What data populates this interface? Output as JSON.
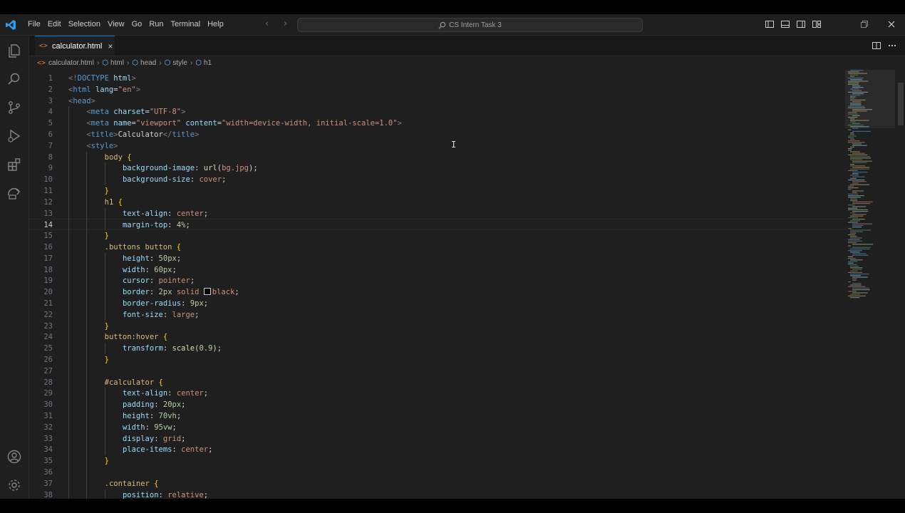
{
  "window": {
    "title": "CS Intern Task 3"
  },
  "menu": [
    "File",
    "Edit",
    "Selection",
    "View",
    "Go",
    "Run",
    "Terminal",
    "Help"
  ],
  "tab": {
    "label": "calculator.html",
    "icon_text": "<>",
    "close": "×"
  },
  "breadcrumb": [
    "calculator.html",
    "html",
    "head",
    "style",
    "h1"
  ],
  "editor": {
    "current_line": 14,
    "lines": [
      {
        "n": "1",
        "indent": 0,
        "tokens": [
          [
            "punc",
            "<!"
          ],
          [
            "tag",
            "DOCTYPE "
          ],
          [
            "attr",
            "html"
          ],
          [
            "punc",
            ">"
          ]
        ]
      },
      {
        "n": "2",
        "indent": 0,
        "tokens": [
          [
            "punc",
            "<"
          ],
          [
            "tag",
            "html "
          ],
          [
            "attr",
            "lang"
          ],
          [
            "text",
            "="
          ],
          [
            "str",
            "\"en\""
          ],
          [
            "punc",
            ">"
          ]
        ]
      },
      {
        "n": "3",
        "indent": 0,
        "tokens": [
          [
            "punc",
            "<"
          ],
          [
            "tag",
            "head"
          ],
          [
            "punc",
            ">"
          ]
        ]
      },
      {
        "n": "4",
        "indent": 1,
        "tokens": [
          [
            "punc",
            "<"
          ],
          [
            "tag",
            "meta "
          ],
          [
            "attr",
            "charset"
          ],
          [
            "text",
            "="
          ],
          [
            "str",
            "\"UTF-8\""
          ],
          [
            "punc",
            ">"
          ]
        ]
      },
      {
        "n": "5",
        "indent": 1,
        "tokens": [
          [
            "punc",
            "<"
          ],
          [
            "tag",
            "meta "
          ],
          [
            "attr",
            "name"
          ],
          [
            "text",
            "="
          ],
          [
            "str",
            "\"viewport\" "
          ],
          [
            "attr",
            "content"
          ],
          [
            "text",
            "="
          ],
          [
            "str",
            "\"width=device-width, initial-scale=1.0\""
          ],
          [
            "punc",
            ">"
          ]
        ]
      },
      {
        "n": "6",
        "indent": 1,
        "tokens": [
          [
            "punc",
            "<"
          ],
          [
            "tag",
            "title"
          ],
          [
            "punc",
            ">"
          ],
          [
            "text",
            "Calculator"
          ],
          [
            "punc",
            "</"
          ],
          [
            "tag",
            "title"
          ],
          [
            "punc",
            ">"
          ]
        ]
      },
      {
        "n": "7",
        "indent": 1,
        "tokens": [
          [
            "punc",
            "<"
          ],
          [
            "tag",
            "style"
          ],
          [
            "punc",
            ">"
          ]
        ]
      },
      {
        "n": "8",
        "indent": 2,
        "tokens": [
          [
            "sel",
            "body "
          ],
          [
            "brace",
            "{"
          ]
        ]
      },
      {
        "n": "9",
        "indent": 3,
        "tokens": [
          [
            "prop",
            "background-image"
          ],
          [
            "text",
            ": "
          ],
          [
            "fn",
            "url"
          ],
          [
            "text",
            "("
          ],
          [
            "val",
            "bg.jpg"
          ],
          [
            "text",
            ");"
          ]
        ]
      },
      {
        "n": "10",
        "indent": 3,
        "tokens": [
          [
            "prop",
            "background-size"
          ],
          [
            "text",
            ": "
          ],
          [
            "val",
            "cover"
          ],
          [
            "text",
            ";"
          ]
        ]
      },
      {
        "n": "11",
        "indent": 2,
        "tokens": [
          [
            "brace",
            "}"
          ]
        ]
      },
      {
        "n": "12",
        "indent": 2,
        "tokens": [
          [
            "sel",
            "h1 "
          ],
          [
            "brace",
            "{"
          ]
        ]
      },
      {
        "n": "13",
        "indent": 3,
        "tokens": [
          [
            "prop",
            "text-align"
          ],
          [
            "text",
            ": "
          ],
          [
            "val",
            "center"
          ],
          [
            "text",
            ";"
          ]
        ]
      },
      {
        "n": "14",
        "indent": 3,
        "tokens": [
          [
            "prop",
            "margin-top"
          ],
          [
            "text",
            ": "
          ],
          [
            "num",
            "4%"
          ],
          [
            "text",
            ";"
          ]
        ]
      },
      {
        "n": "15",
        "indent": 2,
        "tokens": [
          [
            "brace",
            "}"
          ]
        ]
      },
      {
        "n": "16",
        "indent": 2,
        "tokens": [
          [
            "sel",
            ".buttons button "
          ],
          [
            "brace",
            "{"
          ]
        ]
      },
      {
        "n": "17",
        "indent": 3,
        "tokens": [
          [
            "prop",
            "height"
          ],
          [
            "text",
            ": "
          ],
          [
            "num",
            "50px"
          ],
          [
            "text",
            ";"
          ]
        ]
      },
      {
        "n": "18",
        "indent": 3,
        "tokens": [
          [
            "prop",
            "width"
          ],
          [
            "text",
            ": "
          ],
          [
            "num",
            "60px"
          ],
          [
            "text",
            ";"
          ]
        ]
      },
      {
        "n": "19",
        "indent": 3,
        "tokens": [
          [
            "prop",
            "cursor"
          ],
          [
            "text",
            ": "
          ],
          [
            "val",
            "pointer"
          ],
          [
            "text",
            ";"
          ]
        ]
      },
      {
        "n": "20",
        "indent": 3,
        "tokens": [
          [
            "prop",
            "border"
          ],
          [
            "text",
            ": "
          ],
          [
            "num",
            "2px "
          ],
          [
            "val",
            "solid "
          ],
          [
            "swatch",
            ""
          ],
          [
            "val",
            "black"
          ],
          [
            "text",
            ";"
          ]
        ]
      },
      {
        "n": "21",
        "indent": 3,
        "tokens": [
          [
            "prop",
            "border-radius"
          ],
          [
            "text",
            ": "
          ],
          [
            "num",
            "9px"
          ],
          [
            "text",
            ";"
          ]
        ]
      },
      {
        "n": "22",
        "indent": 3,
        "tokens": [
          [
            "prop",
            "font-size"
          ],
          [
            "text",
            ": "
          ],
          [
            "val",
            "large"
          ],
          [
            "text",
            ";"
          ]
        ]
      },
      {
        "n": "23",
        "indent": 2,
        "tokens": [
          [
            "brace",
            "}"
          ]
        ]
      },
      {
        "n": "24",
        "indent": 2,
        "tokens": [
          [
            "sel",
            "button:hover "
          ],
          [
            "brace",
            "{"
          ]
        ]
      },
      {
        "n": "25",
        "indent": 3,
        "tokens": [
          [
            "prop",
            "transform"
          ],
          [
            "text",
            ": "
          ],
          [
            "fn",
            "scale"
          ],
          [
            "text",
            "("
          ],
          [
            "num",
            "0.9"
          ],
          [
            "text",
            ");"
          ]
        ]
      },
      {
        "n": "26",
        "indent": 2,
        "tokens": [
          [
            "brace",
            "}"
          ]
        ]
      },
      {
        "n": "27",
        "indent": 0,
        "tokens": []
      },
      {
        "n": "28",
        "indent": 2,
        "tokens": [
          [
            "sel",
            "#calculator "
          ],
          [
            "brace",
            "{"
          ]
        ]
      },
      {
        "n": "29",
        "indent": 3,
        "tokens": [
          [
            "prop",
            "text-align"
          ],
          [
            "text",
            ": "
          ],
          [
            "val",
            "center"
          ],
          [
            "text",
            ";"
          ]
        ]
      },
      {
        "n": "30",
        "indent": 3,
        "tokens": [
          [
            "prop",
            "padding"
          ],
          [
            "text",
            ": "
          ],
          [
            "num",
            "20px"
          ],
          [
            "text",
            ";"
          ]
        ]
      },
      {
        "n": "31",
        "indent": 3,
        "tokens": [
          [
            "prop",
            "height"
          ],
          [
            "text",
            ": "
          ],
          [
            "num",
            "70vh"
          ],
          [
            "text",
            ";"
          ]
        ]
      },
      {
        "n": "32",
        "indent": 3,
        "tokens": [
          [
            "prop",
            "width"
          ],
          [
            "text",
            ": "
          ],
          [
            "num",
            "95vw"
          ],
          [
            "text",
            ";"
          ]
        ]
      },
      {
        "n": "33",
        "indent": 3,
        "tokens": [
          [
            "prop",
            "display"
          ],
          [
            "text",
            ": "
          ],
          [
            "val",
            "grid"
          ],
          [
            "text",
            ";"
          ]
        ]
      },
      {
        "n": "34",
        "indent": 3,
        "tokens": [
          [
            "prop",
            "place-items"
          ],
          [
            "text",
            ": "
          ],
          [
            "val",
            "center"
          ],
          [
            "text",
            ";"
          ]
        ]
      },
      {
        "n": "35",
        "indent": 2,
        "tokens": [
          [
            "brace",
            "}"
          ]
        ]
      },
      {
        "n": "36",
        "indent": 0,
        "tokens": []
      },
      {
        "n": "37",
        "indent": 2,
        "tokens": [
          [
            "sel",
            ".container "
          ],
          [
            "brace",
            "{"
          ]
        ]
      },
      {
        "n": "38",
        "indent": 3,
        "tokens": [
          [
            "prop",
            "position"
          ],
          [
            "text",
            ": "
          ],
          [
            "val",
            "relative"
          ],
          [
            "text",
            ";"
          ]
        ]
      }
    ]
  }
}
